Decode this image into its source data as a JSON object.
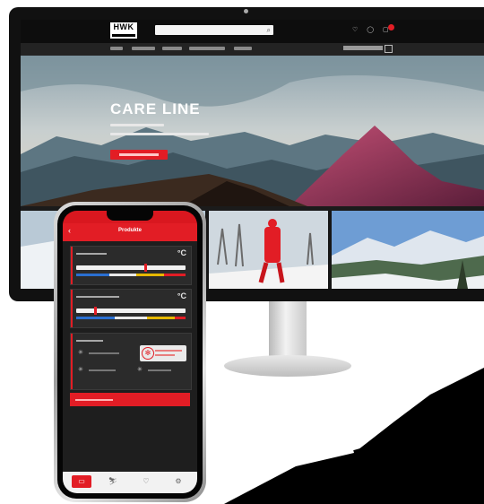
{
  "website": {
    "brand": "HWK",
    "hero": {
      "title": "CARE LINE"
    }
  },
  "app": {
    "screen_title": "Produkte",
    "back_icon": "back-arrow-icon",
    "sections": [
      {
        "id": "snow-temperature",
        "unit": "°C"
      },
      {
        "id": "air-temperature",
        "unit": "°C"
      },
      {
        "id": "recommendation"
      }
    ],
    "slider_bands": [
      "#2a6fd1",
      "#e9e9e9",
      "#e6b800",
      "#e21d25"
    ],
    "slider_levels": {
      "snow": 0.62,
      "air": 0.16
    },
    "tabs": [
      {
        "icon": "products-icon",
        "active": true
      },
      {
        "icon": "skier-icon",
        "active": false
      },
      {
        "icon": "favorite-icon",
        "active": false
      },
      {
        "icon": "settings-icon",
        "active": false
      }
    ]
  },
  "colors": {
    "brand_red": "#e21d25",
    "dark_bg": "#1e1e1e"
  }
}
